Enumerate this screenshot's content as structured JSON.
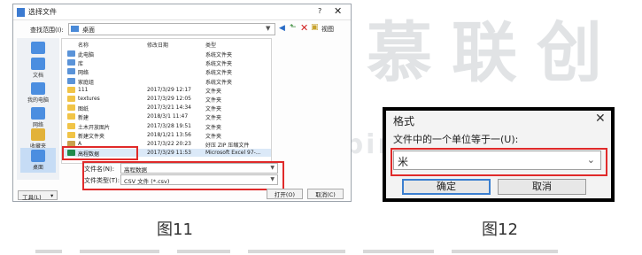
{
  "watermark": {
    "brand": "柏慕联创",
    "url": "www.lcbim.com"
  },
  "dialog1": {
    "title": "选择文件",
    "help": "?",
    "close": "✕",
    "look_in_label": "查找范围(I):",
    "look_in_value": "桌面",
    "tools_label": "视图",
    "places": [
      "",
      "文档",
      "",
      "我的电脑",
      "",
      "网络",
      "收藏夹",
      "桌面"
    ],
    "columns": {
      "name": "名称",
      "date": "修改日期",
      "type": "类型"
    },
    "rows": [
      {
        "name": "此电脑",
        "date": "",
        "type": "系统文件夹",
        "icon": "system-icon"
      },
      {
        "name": "库",
        "date": "",
        "type": "系统文件夹",
        "icon": "system-icon"
      },
      {
        "name": "网络",
        "date": "",
        "type": "系统文件夹",
        "icon": "system-icon"
      },
      {
        "name": "家庭组",
        "date": "",
        "type": "系统文件夹",
        "icon": "system-icon"
      },
      {
        "name": "111",
        "date": "2017/3/29 12:17",
        "type": "文件夹",
        "icon": "folder-icon"
      },
      {
        "name": "textures",
        "date": "2017/3/29 12:05",
        "type": "文件夹",
        "icon": "folder-icon"
      },
      {
        "name": "图纸",
        "date": "2017/3/21 14:34",
        "type": "文件夹",
        "icon": "folder-icon"
      },
      {
        "name": "新建",
        "date": "2018/3/1 11:47",
        "type": "文件夹",
        "icon": "folder-icon"
      },
      {
        "name": "土木开放图片",
        "date": "2017/3/28 19:51",
        "type": "文件夹",
        "icon": "folder-icon"
      },
      {
        "name": "新建文件夹",
        "date": "2018/1/21 13:56",
        "type": "文件夹",
        "icon": "folder-icon"
      },
      {
        "name": "A",
        "date": "2017/3/22 20:23",
        "type": "好压 ZIP 压缩文件",
        "icon": "zip-icon"
      },
      {
        "name": "高程数据",
        "date": "2017/3/29 11:53",
        "type": "Microsoft Excel 97-...",
        "icon": "excel-icon"
      }
    ],
    "filename_label": "文件名(N):",
    "filename_value": "高程数据",
    "filetype_label": "文件类型(T):",
    "filetype_value": "CSV 文件 (*.csv)",
    "tools_button": "工具(L)",
    "open_button": "打开(O)",
    "cancel_button": "取消(C)"
  },
  "dialog2": {
    "title": "格式",
    "close": "✕",
    "prompt": "文件中的一个单位等于一(U):",
    "unit_value": "米",
    "ok_button": "确定",
    "cancel_button": "取消"
  },
  "captions": {
    "fig11": "图11",
    "fig12": "图12"
  },
  "colors": {
    "highlight": "#e02a2a",
    "accent": "#3b7fd0"
  }
}
